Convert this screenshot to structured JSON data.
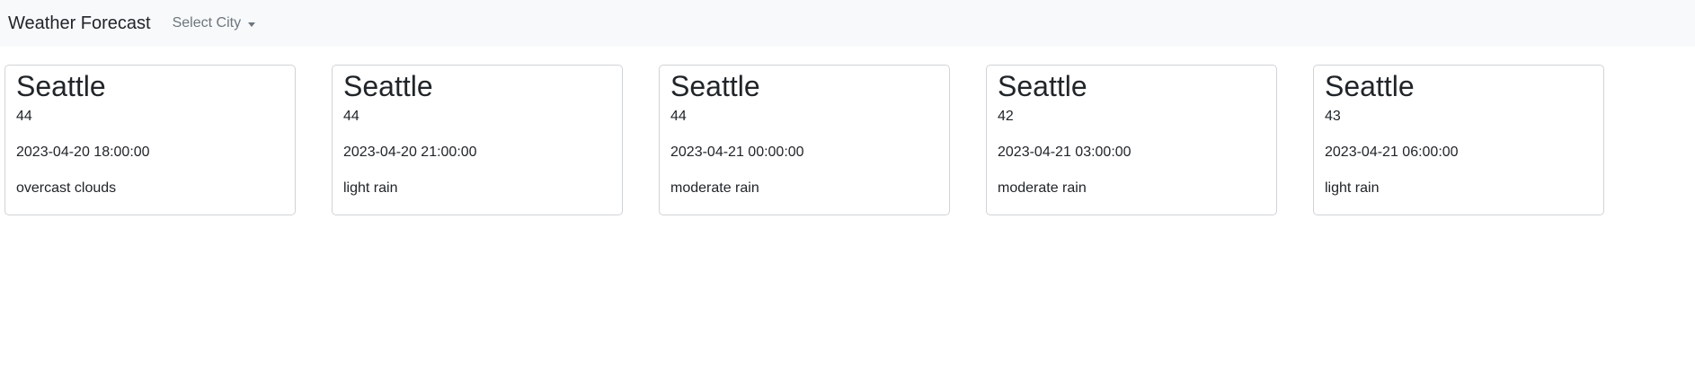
{
  "navbar": {
    "brand": "Weather Forecast",
    "city_dropdown_label": "Select City"
  },
  "forecasts": [
    {
      "city": "Seattle",
      "temp": "44",
      "datetime": "2023-04-20 18:00:00",
      "description": "overcast clouds"
    },
    {
      "city": "Seattle",
      "temp": "44",
      "datetime": "2023-04-20 21:00:00",
      "description": "light rain"
    },
    {
      "city": "Seattle",
      "temp": "44",
      "datetime": "2023-04-21 00:00:00",
      "description": "moderate rain"
    },
    {
      "city": "Seattle",
      "temp": "42",
      "datetime": "2023-04-21 03:00:00",
      "description": "moderate rain"
    },
    {
      "city": "Seattle",
      "temp": "43",
      "datetime": "2023-04-21 06:00:00",
      "description": "light rain"
    }
  ],
  "colors": {
    "navbar_bg": "#f8f9fa",
    "card_border": "#d0d3d6",
    "text": "#212529",
    "muted": "#6c757d"
  }
}
